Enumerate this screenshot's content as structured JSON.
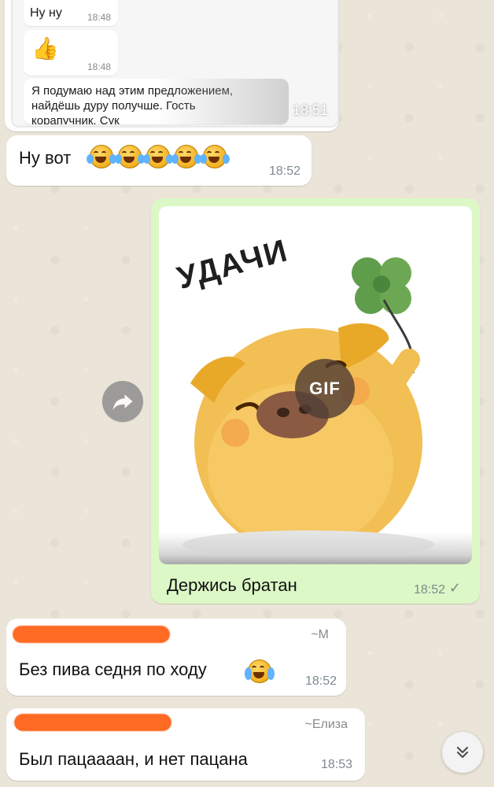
{
  "colors": {
    "background": "#ebe4d8",
    "incoming_bubble": "#ffffff",
    "outgoing_bubble": "#dcf8c6",
    "time": "#7e8a8f",
    "redaction": "#ff6a24",
    "gif_badge": "#523e34"
  },
  "quoted": {
    "messages": [
      {
        "text": "Ну ну",
        "time": "18:48"
      },
      {
        "text": "👍",
        "time": "18:48",
        "icon": "thumbs-up-icon"
      },
      {
        "text": "Я подумаю над этим предложением, найдёшь дуру получше. Гость корапучник. Сук",
        "time": ""
      }
    ],
    "time": "18:51"
  },
  "messages": [
    {
      "text": "Ну вот",
      "time": "18:52",
      "emoji": "rolling-on-floor-laughing-icon",
      "emoji_count": 5
    },
    {
      "type": "gif",
      "badge": "GIF",
      "sticker_text": "УДАЧИ",
      "caption": "Держись братан",
      "time": "18:52",
      "status": "✓"
    },
    {
      "sender_mark": "~М",
      "text": "Без пива седня по ходу",
      "time": "18:52",
      "emoji": "loudly-crying-face-icon"
    },
    {
      "sender_mark": "~Елиза",
      "text": "Был пацаааан, и нет пацана",
      "time": "18:53"
    }
  ],
  "icons": {
    "forward": "forward-arrow-icon",
    "scroll_down": "double-chevron-down-icon"
  }
}
